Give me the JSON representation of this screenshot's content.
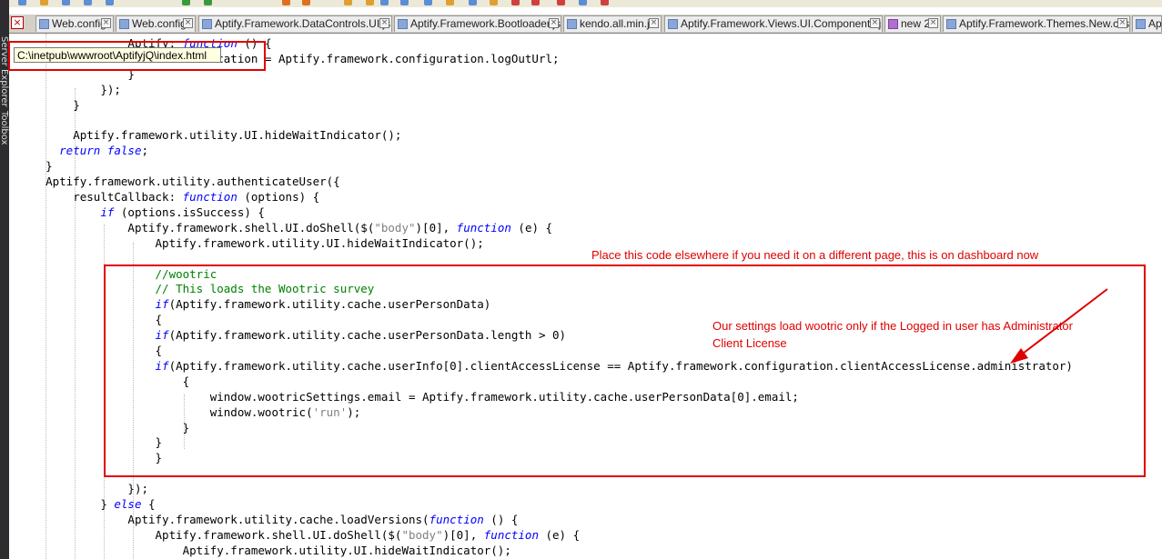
{
  "tabs": [
    {
      "label": "Web.config"
    },
    {
      "label": "Web.config"
    },
    {
      "label": "Aptify.Framework.DataControls.UI.js"
    },
    {
      "label": "Aptify.Framework.Bootloader.js"
    },
    {
      "label": "kendo.all.min.js"
    },
    {
      "label": "Aptify.Framework.Views.UI.Components.js"
    },
    {
      "label": "new 2"
    },
    {
      "label": "Aptify.Framework.Themes.New.css"
    },
    {
      "label": "Apt"
    }
  ],
  "side_panel": {
    "server_explorer": "Server Explorer",
    "toolbox": "Toolbox"
  },
  "tooltip_path": "C:\\inetpub\\wwwroot\\AptifyjQ\\index.html",
  "code_lines": [
    {
      "indent": "                ",
      "parts": [
        {
          "t": "Aptify"
        },
        {
          "t": ": "
        },
        {
          "t": "function",
          "c": "kw"
        },
        {
          "t": " () {"
        }
      ]
    },
    {
      "indent": "                    ",
      "parts": [
        {
          "t": "window.location = Aptify.framework.configuration.logOutUrl;"
        }
      ]
    },
    {
      "indent": "                ",
      "parts": [
        {
          "t": "}"
        }
      ]
    },
    {
      "indent": "            ",
      "parts": [
        {
          "t": "});"
        }
      ]
    },
    {
      "indent": "        ",
      "parts": [
        {
          "t": "}"
        }
      ]
    },
    {
      "indent": "",
      "parts": [
        {
          "t": ""
        }
      ]
    },
    {
      "indent": "        ",
      "parts": [
        {
          "t": "Aptify.framework.utility.UI.hideWaitIndicator();"
        }
      ]
    },
    {
      "indent": "      ",
      "parts": [
        {
          "t": "return",
          "c": "kw"
        },
        {
          "t": " "
        },
        {
          "t": "false",
          "c": "kw"
        },
        {
          "t": ";"
        }
      ]
    },
    {
      "indent": "    ",
      "parts": [
        {
          "t": "}"
        }
      ]
    },
    {
      "indent": "    ",
      "parts": [
        {
          "t": "Aptify.framework.utility.authenticateUser({"
        }
      ]
    },
    {
      "indent": "        ",
      "parts": [
        {
          "t": "resultCallback: "
        },
        {
          "t": "function",
          "c": "kw"
        },
        {
          "t": " (options) {"
        }
      ]
    },
    {
      "indent": "            ",
      "parts": [
        {
          "t": "if",
          "c": "kw"
        },
        {
          "t": " (options.isSuccess) {"
        }
      ]
    },
    {
      "indent": "                ",
      "parts": [
        {
          "t": "Aptify.framework.shell.UI.doShell($("
        },
        {
          "t": "\"body\"",
          "c": "st"
        },
        {
          "t": ")[0], "
        },
        {
          "t": "function",
          "c": "kw"
        },
        {
          "t": " (e) {"
        }
      ]
    },
    {
      "indent": "                    ",
      "parts": [
        {
          "t": "Aptify.framework.utility.UI.hideWaitIndicator();"
        }
      ]
    },
    {
      "indent": "",
      "parts": [
        {
          "t": ""
        }
      ]
    },
    {
      "indent": "                    ",
      "parts": [
        {
          "t": "//wootric",
          "c": "cm"
        }
      ]
    },
    {
      "indent": "                    ",
      "parts": [
        {
          "t": "// This loads the Wootric survey",
          "c": "cm"
        }
      ]
    },
    {
      "indent": "                    ",
      "parts": [
        {
          "t": "if",
          "c": "kw"
        },
        {
          "t": "(Aptify.framework.utility.cache.userPersonData)"
        }
      ]
    },
    {
      "indent": "                    ",
      "parts": [
        {
          "t": "{"
        }
      ]
    },
    {
      "indent": "                    ",
      "parts": [
        {
          "t": "if",
          "c": "kw"
        },
        {
          "t": "(Aptify.framework.utility.cache.userPersonData.length > 0)"
        }
      ]
    },
    {
      "indent": "                    ",
      "parts": [
        {
          "t": "{"
        }
      ]
    },
    {
      "indent": "                    ",
      "parts": [
        {
          "t": "if",
          "c": "kw"
        },
        {
          "t": "(Aptify.framework.utility.cache.userInfo[0].clientAccessLicense == Aptify.framework.configuration.clientAccessLicense.administrator)"
        }
      ]
    },
    {
      "indent": "                        ",
      "parts": [
        {
          "t": "{"
        }
      ]
    },
    {
      "indent": "                            ",
      "parts": [
        {
          "t": "window.wootricSettings.email = Aptify.framework.utility.cache.userPersonData[0].email;"
        }
      ]
    },
    {
      "indent": "                            ",
      "parts": [
        {
          "t": "window.wootric("
        },
        {
          "t": "'run'",
          "c": "st"
        },
        {
          "t": ");"
        }
      ]
    },
    {
      "indent": "                        ",
      "parts": [
        {
          "t": "}"
        }
      ]
    },
    {
      "indent": "                    ",
      "parts": [
        {
          "t": "}"
        }
      ]
    },
    {
      "indent": "                    ",
      "parts": [
        {
          "t": "}"
        }
      ]
    },
    {
      "indent": "",
      "parts": [
        {
          "t": ""
        }
      ]
    },
    {
      "indent": "                ",
      "parts": [
        {
          "t": "});"
        }
      ]
    },
    {
      "indent": "            ",
      "parts": [
        {
          "t": "} "
        },
        {
          "t": "else",
          "c": "kw"
        },
        {
          "t": " {"
        }
      ]
    },
    {
      "indent": "                ",
      "parts": [
        {
          "t": "Aptify.framework.utility.cache.loadVersions("
        },
        {
          "t": "function",
          "c": "kw"
        },
        {
          "t": " () {"
        }
      ]
    },
    {
      "indent": "                    ",
      "parts": [
        {
          "t": "Aptify.framework.shell.UI.doShell($("
        },
        {
          "t": "\"body\"",
          "c": "st"
        },
        {
          "t": ")[0], "
        },
        {
          "t": "function",
          "c": "kw"
        },
        {
          "t": " (e) {"
        }
      ]
    },
    {
      "indent": "                        ",
      "parts": [
        {
          "t": "Aptify.framework.utility.UI.hideWaitIndicator();"
        }
      ]
    }
  ],
  "annotations": {
    "top_note": "Place this code elsewhere if you need it on a different page, this is on dashboard now",
    "side_note_line1": "Our settings load wootric only if the Logged in user has Administrator",
    "side_note_line2": "Client License"
  },
  "colors": {
    "annotation": "#e00000",
    "keyword": "#0000ff",
    "comment": "#008000"
  }
}
